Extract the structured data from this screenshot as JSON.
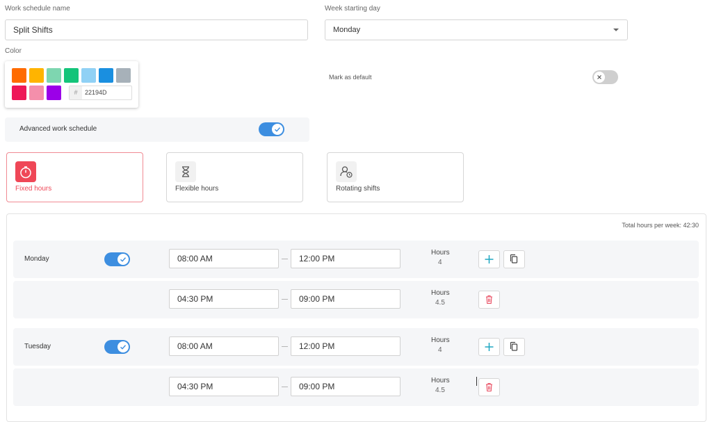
{
  "form": {
    "name_label": "Work schedule name",
    "name_value": "Split Shifts",
    "week_label": "Week starting day",
    "week_value": "Monday",
    "color_label": "Color",
    "hex_value": "22194D",
    "colors": [
      "#ff6b00",
      "#ffb400",
      "#7ed6b0",
      "#14c47a",
      "#90d1f5",
      "#1a8fe0",
      "#a7b1b9",
      "#ee1758",
      "#f48fab",
      "#9b00e8"
    ],
    "default_label": "Mark as default",
    "default_on": false,
    "advanced_label": "Advanced work schedule",
    "advanced_on": true
  },
  "types": [
    {
      "label": "Fixed hours",
      "icon": "stopwatch-icon",
      "active": true
    },
    {
      "label": "Flexible hours",
      "icon": "hourglass-icon",
      "active": false
    },
    {
      "label": "Rotating shifts",
      "icon": "user-clock-icon",
      "active": false
    }
  ],
  "schedule": {
    "total_label": "Total hours per week: 42:30",
    "hours_label": "Hours",
    "days": [
      {
        "name": "Monday",
        "enabled": true,
        "shifts": [
          {
            "start": "08:00 AM",
            "end": "12:00 PM",
            "hours": "4"
          },
          {
            "start": "04:30 PM",
            "end": "09:00 PM",
            "hours": "4.5"
          }
        ]
      },
      {
        "name": "Tuesday",
        "enabled": true,
        "shifts": [
          {
            "start": "08:00 AM",
            "end": "12:00 PM",
            "hours": "4"
          },
          {
            "start": "04:30 PM",
            "end": "09:00 PM",
            "hours": "4.5"
          }
        ]
      }
    ]
  }
}
